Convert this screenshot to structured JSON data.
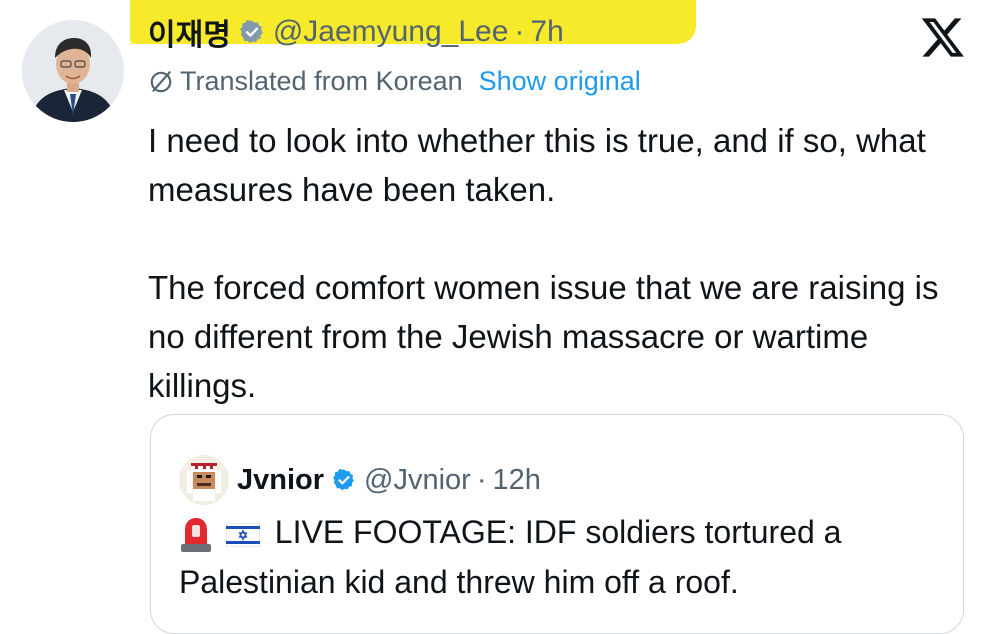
{
  "colors": {
    "highlight": "#f7ea2a",
    "text_primary": "#0f1419",
    "text_secondary": "#536471",
    "link": "#1d9bf0",
    "verified_badge": "#829aab",
    "quote_verified_badge": "#1d9bf0",
    "border": "#cfd9de"
  },
  "post": {
    "author_name": "이재명",
    "handle": "@Jaemyung_Lee",
    "separator": "·",
    "time": "7h",
    "translated_label": "Translated from Korean",
    "show_original": "Show original",
    "paragraphs": [
      "I need to look into whether this is true, and if so, what measures have been taken.",
      "The forced comfort women issue that we are raising is no different from the Jewish massacre or wartime killings."
    ],
    "icons": {
      "avatar": "avatar-photo",
      "verified": "gray-verified-badge-icon",
      "translate": "translate-slash-icon",
      "x": "x-logo-icon"
    }
  },
  "quote": {
    "author_name": "Jvnior",
    "handle": "@Jvnior",
    "separator": "·",
    "time": "12h",
    "text": "LIVE FOOTAGE: IDF soldiers tortured a Palestinian kid and threw him off a roof.",
    "icons": {
      "avatar": "avatar-cartoon",
      "verified": "blue-verified-badge-icon",
      "siren": "rotating-light-emoji",
      "flag": "israel-flag-emoji"
    }
  }
}
